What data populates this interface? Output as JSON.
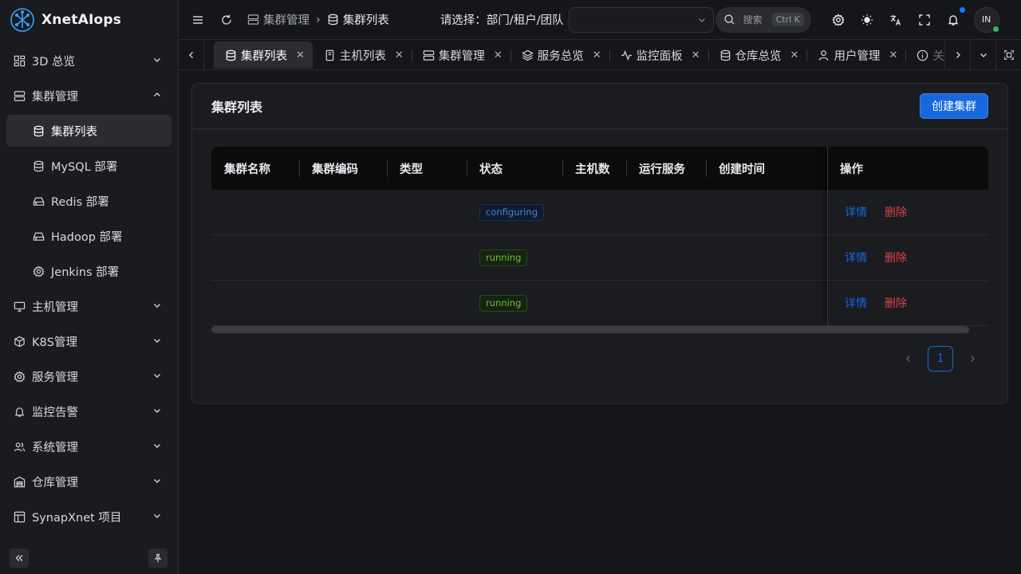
{
  "app": {
    "name": "XnetAIops"
  },
  "sidebar": {
    "items": [
      {
        "label": "3D 总览",
        "icon": "dashboard-icon",
        "expanded": false
      },
      {
        "label": "集群管理",
        "icon": "server-icon",
        "expanded": true
      },
      {
        "label": "集群列表",
        "icon": "database-icon",
        "sub": true,
        "active": true
      },
      {
        "label": "MySQL 部署",
        "icon": "database-icon",
        "sub": true
      },
      {
        "label": "Redis 部署",
        "icon": "hard-drive-icon",
        "sub": true
      },
      {
        "label": "Hadoop 部署",
        "icon": "hard-drive-icon",
        "sub": true
      },
      {
        "label": "Jenkins 部署",
        "icon": "gear-icon",
        "sub": true
      },
      {
        "label": "主机管理",
        "icon": "monitor-icon",
        "expanded": false
      },
      {
        "label": "K8S管理",
        "icon": "box-icon",
        "expanded": false
      },
      {
        "label": "服务管理",
        "icon": "gear-icon",
        "expanded": false
      },
      {
        "label": "监控告警",
        "icon": "bell-icon",
        "expanded": false
      },
      {
        "label": "系统管理",
        "icon": "users-icon",
        "expanded": false
      },
      {
        "label": "仓库管理",
        "icon": "warehouse-icon",
        "expanded": false
      },
      {
        "label": "SynapXnet 项目",
        "icon": "layout-icon",
        "expanded": false
      }
    ]
  },
  "header": {
    "breadcrumb": [
      "集群管理",
      "集群列表"
    ],
    "select_label": "请选择：部门/租户/团队",
    "select_value": "",
    "search_placeholder": "搜索",
    "search_shortcut": "Ctrl K",
    "avatar_initials": "IN"
  },
  "tabs": [
    {
      "label": "集群列表",
      "icon": "database-icon",
      "active": true
    },
    {
      "label": "主机列表",
      "icon": "file-icon"
    },
    {
      "label": "集群管理",
      "icon": "server-icon"
    },
    {
      "label": "服务总览",
      "icon": "layers-icon"
    },
    {
      "label": "监控面板",
      "icon": "activity-icon"
    },
    {
      "label": "仓库总览",
      "icon": "database-icon"
    },
    {
      "label": "用户管理",
      "icon": "user-icon"
    },
    {
      "label": "关",
      "icon": "info-icon"
    }
  ],
  "card": {
    "title": "集群列表",
    "create_button": "创建集群"
  },
  "table": {
    "columns": [
      "集群名称",
      "集群编码",
      "类型",
      "状态",
      "主机数",
      "运行服务",
      "创建时间",
      "操作"
    ],
    "rows": [
      {
        "name": "",
        "code": "",
        "type": "",
        "status": "configuring",
        "hosts": "",
        "services": "",
        "created": "",
        "actions": [
          "详情",
          "删除"
        ]
      },
      {
        "name": "",
        "code": "",
        "type": "",
        "status": "running",
        "hosts": "",
        "services": "",
        "created": "",
        "actions": [
          "详情",
          "删除"
        ]
      },
      {
        "name": "",
        "code": "",
        "type": "",
        "status": "running",
        "hosts": "",
        "services": "",
        "created": "",
        "actions": [
          "详情",
          "删除"
        ]
      }
    ]
  },
  "pagination": {
    "current": "1"
  },
  "colors": {
    "primary": "#1668dc",
    "danger": "#dc4446",
    "running": "#6abe39",
    "configuring": "#3c89e8"
  }
}
